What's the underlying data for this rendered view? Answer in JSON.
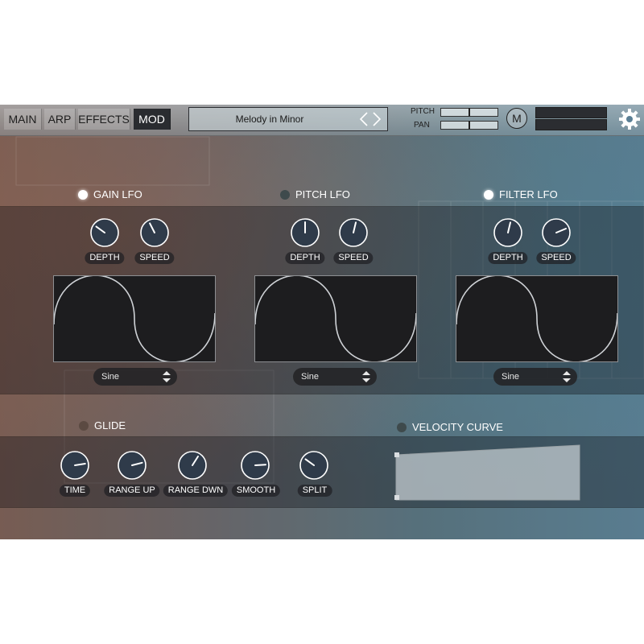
{
  "tabs": [
    {
      "label": "MAIN",
      "active": false
    },
    {
      "label": "ARP",
      "active": false
    },
    {
      "label": "EFFECTS",
      "active": false
    },
    {
      "label": "MOD",
      "active": true
    }
  ],
  "preset": {
    "name": "Melody in Minor"
  },
  "mini_sliders": {
    "pitch_label": "PITCH",
    "pan_label": "PAN"
  },
  "m_button": "M",
  "gain_lfo": {
    "title": "GAIN LFO",
    "enabled": true,
    "knobs": [
      {
        "label": "DEPTH",
        "value": 0.3
      },
      {
        "label": "SPEED",
        "value": 0.4
      }
    ],
    "waveform": "Sine"
  },
  "pitch_lfo": {
    "title": "PITCH LFO",
    "enabled": false,
    "knobs": [
      {
        "label": "DEPTH",
        "value": 0.5
      },
      {
        "label": "SPEED",
        "value": 0.55
      }
    ],
    "waveform": "Sine"
  },
  "filter_lfo": {
    "title": "FILTER LFO",
    "enabled": true,
    "knobs": [
      {
        "label": "DEPTH",
        "value": 0.55
      },
      {
        "label": "SPEED",
        "value": 0.75
      }
    ],
    "waveform": "Sine"
  },
  "glide": {
    "title": "GLIDE",
    "enabled": false,
    "knobs": [
      {
        "label": "TIME",
        "value": 0.8
      },
      {
        "label": "RANGE UP",
        "value": 0.78
      },
      {
        "label": "RANGE DWN",
        "value": 0.62
      },
      {
        "label": "SMOOTH",
        "value": 0.82
      },
      {
        "label": "SPLIT",
        "value": 0.3
      }
    ]
  },
  "velocity_curve": {
    "title": "VELOCITY CURVE",
    "enabled": false
  },
  "colors": {
    "accent": "#ffffff",
    "panel": "#1d1d1f",
    "knob_face": "#2f3b4a"
  }
}
